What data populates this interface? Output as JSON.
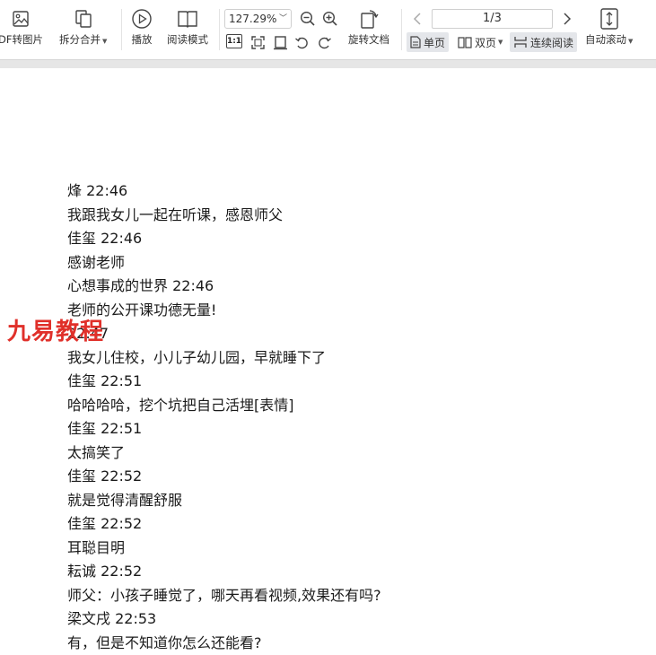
{
  "toolbar": {
    "pdf_to_image": "DF转图片",
    "split_merge": "拆分合并",
    "play": "播放",
    "reading_mode": "阅读模式",
    "zoom_level": "127.29%",
    "rotate_doc": "旋转文档",
    "page_indicator": "1/3",
    "single_page": "单页",
    "double_page": "双页",
    "continuous": "连续阅读",
    "auto_scroll": "自动滚动",
    "fit_label": "1:1"
  },
  "document": {
    "lines": [
      "烽 22:46",
      "我跟我女儿一起在听课，感恩师父",
      "佳玺 22:46",
      "感谢老师",
      "心想事成的世界 22:46",
      "老师的公开课功德无量!",
      "    22:47",
      "我女儿住校，小儿子幼儿园，早就睡下了",
      "佳玺 22:51",
      "哈哈哈哈，挖个坑把自己活埋[表情]",
      "佳玺 22:51",
      "太搞笑了",
      "佳玺 22:52",
      "就是觉得清醒舒服",
      "佳玺 22:52",
      "耳聪目明",
      "耘诚 22:52",
      "师父：小孩子睡觉了，哪天再看视频,效果还有吗?",
      "梁文戌 22:53",
      "有，但是不知道你怎么还能看?"
    ]
  },
  "watermark": "九易教程",
  "colors": {
    "watermark": "#e0302a",
    "active_mode_bg": "#e4e6ea",
    "toolbar_border": "#d6d6d6"
  },
  "icons": {
    "pdf_to_image": "image-icon",
    "split_merge": "split-merge-icon",
    "play": "play-icon",
    "reading_mode": "book-icon",
    "zoom_out": "zoom-out-icon",
    "zoom_in": "zoom-in-icon",
    "rotate": "rotate-doc-icon",
    "auto_scroll": "auto-scroll-icon"
  }
}
